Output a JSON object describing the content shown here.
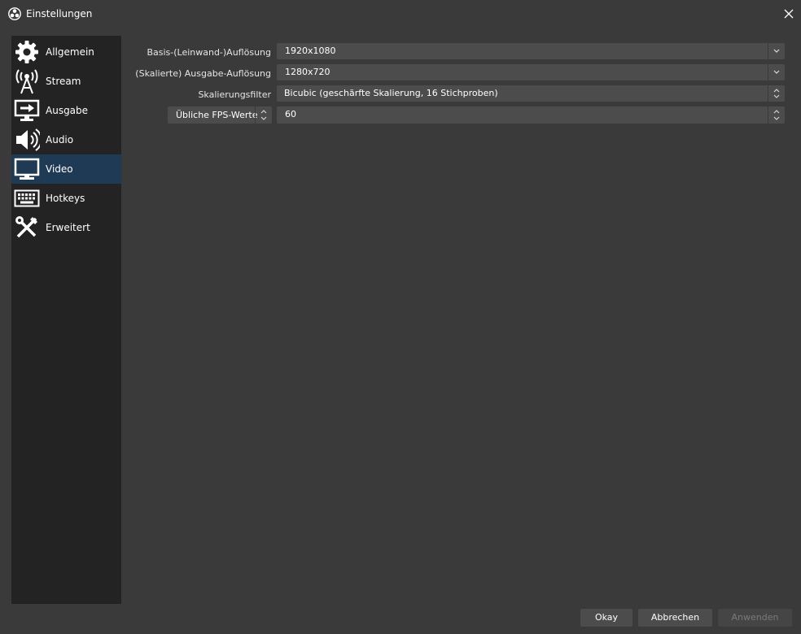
{
  "window": {
    "title": "Einstellungen",
    "app_icon": "obs-logo-icon",
    "close_icon": "close-icon"
  },
  "sidebar": {
    "items": [
      {
        "label": "Allgemein",
        "icon": "gear-icon"
      },
      {
        "label": "Stream",
        "icon": "broadcast-antenna-icon"
      },
      {
        "label": "Ausgabe",
        "icon": "output-icon"
      },
      {
        "label": "Audio",
        "icon": "speaker-icon"
      },
      {
        "label": "Video",
        "icon": "monitor-icon",
        "selected": true
      },
      {
        "label": "Hotkeys",
        "icon": "keyboard-icon"
      },
      {
        "label": "Erweitert",
        "icon": "tools-icon"
      }
    ]
  },
  "video": {
    "base_resolution": {
      "label": "Basis-(Leinwand-)Auflösung",
      "value": "1920x1080"
    },
    "output_resolution": {
      "label": "(Skalierte) Ausgabe-Auflösung",
      "value": "1280x720"
    },
    "downscale_filter": {
      "label": "Skalierungsfilter",
      "value": "Bicubic (geschärfte Skalierung, 16 Stichproben)"
    },
    "fps": {
      "mode": "Übliche FPS-Werte",
      "value": "60"
    }
  },
  "buttons": {
    "ok": "Okay",
    "cancel": "Abbrechen",
    "apply": "Anwenden"
  },
  "colors": {
    "background": "#3a3a3a",
    "sidebar": "#232323",
    "selected": "#1e3a54",
    "control": "#4c4c4c"
  }
}
